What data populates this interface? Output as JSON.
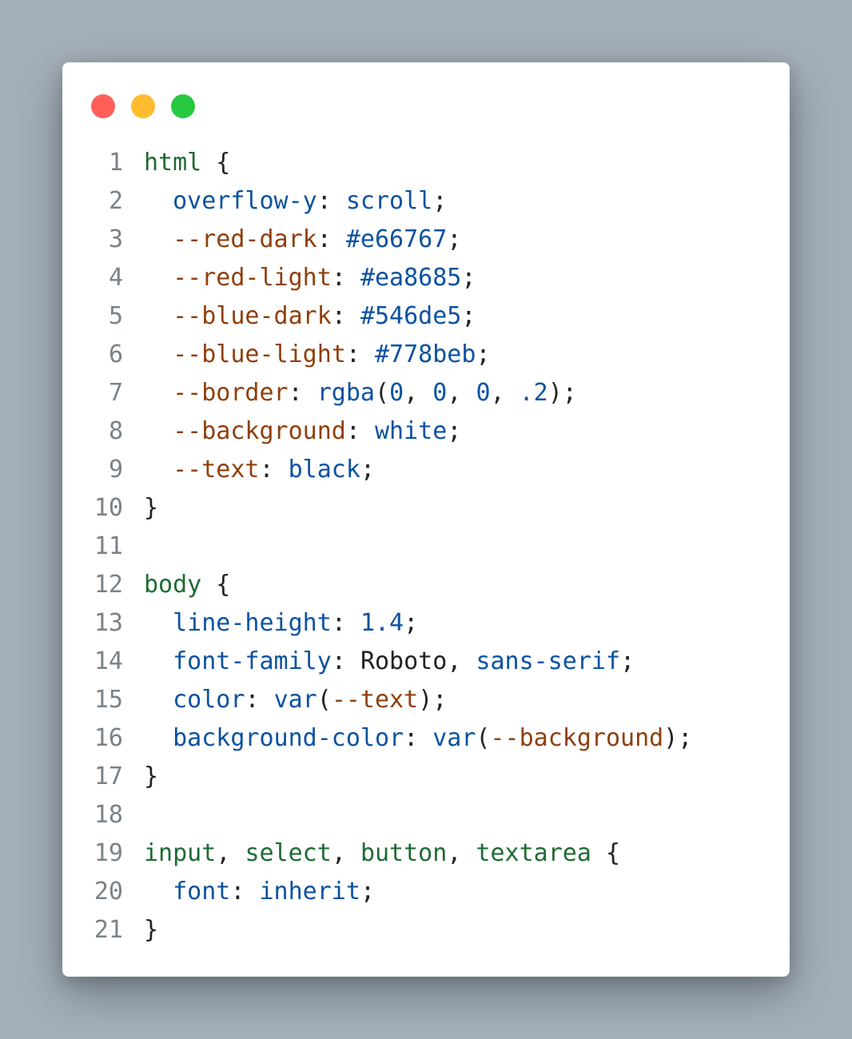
{
  "window": {
    "controls": [
      {
        "name": "close-dot",
        "color": "#ff5f57"
      },
      {
        "name": "minimize-dot",
        "color": "#febc2e"
      },
      {
        "name": "maximize-dot",
        "color": "#28c840"
      }
    ]
  },
  "code": {
    "lines": [
      {
        "n": "1",
        "tokens": [
          {
            "t": "html",
            "k": "sel"
          },
          {
            "t": " {",
            "k": "punc"
          }
        ]
      },
      {
        "n": "2",
        "tokens": [
          {
            "t": "  ",
            "k": "plain"
          },
          {
            "t": "overflow-y",
            "k": "prop"
          },
          {
            "t": ": ",
            "k": "punc"
          },
          {
            "t": "scroll",
            "k": "val"
          },
          {
            "t": ";",
            "k": "punc"
          }
        ]
      },
      {
        "n": "3",
        "tokens": [
          {
            "t": "  ",
            "k": "plain"
          },
          {
            "t": "--red-dark",
            "k": "var"
          },
          {
            "t": ": ",
            "k": "punc"
          },
          {
            "t": "#e66767",
            "k": "val"
          },
          {
            "t": ";",
            "k": "punc"
          }
        ]
      },
      {
        "n": "4",
        "tokens": [
          {
            "t": "  ",
            "k": "plain"
          },
          {
            "t": "--red-light",
            "k": "var"
          },
          {
            "t": ": ",
            "k": "punc"
          },
          {
            "t": "#ea8685",
            "k": "val"
          },
          {
            "t": ";",
            "k": "punc"
          }
        ]
      },
      {
        "n": "5",
        "tokens": [
          {
            "t": "  ",
            "k": "plain"
          },
          {
            "t": "--blue-dark",
            "k": "var"
          },
          {
            "t": ": ",
            "k": "punc"
          },
          {
            "t": "#546de5",
            "k": "val"
          },
          {
            "t": ";",
            "k": "punc"
          }
        ]
      },
      {
        "n": "6",
        "tokens": [
          {
            "t": "  ",
            "k": "plain"
          },
          {
            "t": "--blue-light",
            "k": "var"
          },
          {
            "t": ": ",
            "k": "punc"
          },
          {
            "t": "#778beb",
            "k": "val"
          },
          {
            "t": ";",
            "k": "punc"
          }
        ]
      },
      {
        "n": "7",
        "tokens": [
          {
            "t": "  ",
            "k": "plain"
          },
          {
            "t": "--border",
            "k": "var"
          },
          {
            "t": ": ",
            "k": "punc"
          },
          {
            "t": "rgba",
            "k": "val"
          },
          {
            "t": "(",
            "k": "punc"
          },
          {
            "t": "0",
            "k": "val"
          },
          {
            "t": ", ",
            "k": "punc"
          },
          {
            "t": "0",
            "k": "val"
          },
          {
            "t": ", ",
            "k": "punc"
          },
          {
            "t": "0",
            "k": "val"
          },
          {
            "t": ", ",
            "k": "punc"
          },
          {
            "t": ".2",
            "k": "val"
          },
          {
            "t": ");",
            "k": "punc"
          }
        ]
      },
      {
        "n": "8",
        "tokens": [
          {
            "t": "  ",
            "k": "plain"
          },
          {
            "t": "--background",
            "k": "var"
          },
          {
            "t": ": ",
            "k": "punc"
          },
          {
            "t": "white",
            "k": "val"
          },
          {
            "t": ";",
            "k": "punc"
          }
        ]
      },
      {
        "n": "9",
        "tokens": [
          {
            "t": "  ",
            "k": "plain"
          },
          {
            "t": "--text",
            "k": "var"
          },
          {
            "t": ": ",
            "k": "punc"
          },
          {
            "t": "black",
            "k": "val"
          },
          {
            "t": ";",
            "k": "punc"
          }
        ]
      },
      {
        "n": "10",
        "tokens": [
          {
            "t": "}",
            "k": "punc"
          }
        ]
      },
      {
        "n": "11",
        "tokens": []
      },
      {
        "n": "12",
        "tokens": [
          {
            "t": "body",
            "k": "sel"
          },
          {
            "t": " {",
            "k": "punc"
          }
        ]
      },
      {
        "n": "13",
        "tokens": [
          {
            "t": "  ",
            "k": "plain"
          },
          {
            "t": "line-height",
            "k": "prop"
          },
          {
            "t": ": ",
            "k": "punc"
          },
          {
            "t": "1.4",
            "k": "val"
          },
          {
            "t": ";",
            "k": "punc"
          }
        ]
      },
      {
        "n": "14",
        "tokens": [
          {
            "t": "  ",
            "k": "plain"
          },
          {
            "t": "font-family",
            "k": "prop"
          },
          {
            "t": ": ",
            "k": "punc"
          },
          {
            "t": "Roboto",
            "k": "plain"
          },
          {
            "t": ", ",
            "k": "punc"
          },
          {
            "t": "sans-serif",
            "k": "val"
          },
          {
            "t": ";",
            "k": "punc"
          }
        ]
      },
      {
        "n": "15",
        "tokens": [
          {
            "t": "  ",
            "k": "plain"
          },
          {
            "t": "color",
            "k": "prop"
          },
          {
            "t": ": ",
            "k": "punc"
          },
          {
            "t": "var",
            "k": "val"
          },
          {
            "t": "(",
            "k": "punc"
          },
          {
            "t": "--text",
            "k": "var"
          },
          {
            "t": ");",
            "k": "punc"
          }
        ]
      },
      {
        "n": "16",
        "tokens": [
          {
            "t": "  ",
            "k": "plain"
          },
          {
            "t": "background-color",
            "k": "prop"
          },
          {
            "t": ": ",
            "k": "punc"
          },
          {
            "t": "var",
            "k": "val"
          },
          {
            "t": "(",
            "k": "punc"
          },
          {
            "t": "--background",
            "k": "var"
          },
          {
            "t": ");",
            "k": "punc"
          }
        ]
      },
      {
        "n": "17",
        "tokens": [
          {
            "t": "}",
            "k": "punc"
          }
        ]
      },
      {
        "n": "18",
        "tokens": []
      },
      {
        "n": "19",
        "tokens": [
          {
            "t": "input",
            "k": "sel"
          },
          {
            "t": ", ",
            "k": "punc"
          },
          {
            "t": "select",
            "k": "sel"
          },
          {
            "t": ", ",
            "k": "punc"
          },
          {
            "t": "button",
            "k": "sel"
          },
          {
            "t": ", ",
            "k": "punc"
          },
          {
            "t": "textarea",
            "k": "sel"
          },
          {
            "t": " {",
            "k": "punc"
          }
        ]
      },
      {
        "n": "20",
        "tokens": [
          {
            "t": "  ",
            "k": "plain"
          },
          {
            "t": "font",
            "k": "prop"
          },
          {
            "t": ": ",
            "k": "punc"
          },
          {
            "t": "inherit",
            "k": "val"
          },
          {
            "t": ";",
            "k": "punc"
          }
        ]
      },
      {
        "n": "21",
        "tokens": [
          {
            "t": "}",
            "k": "punc"
          }
        ]
      }
    ]
  }
}
